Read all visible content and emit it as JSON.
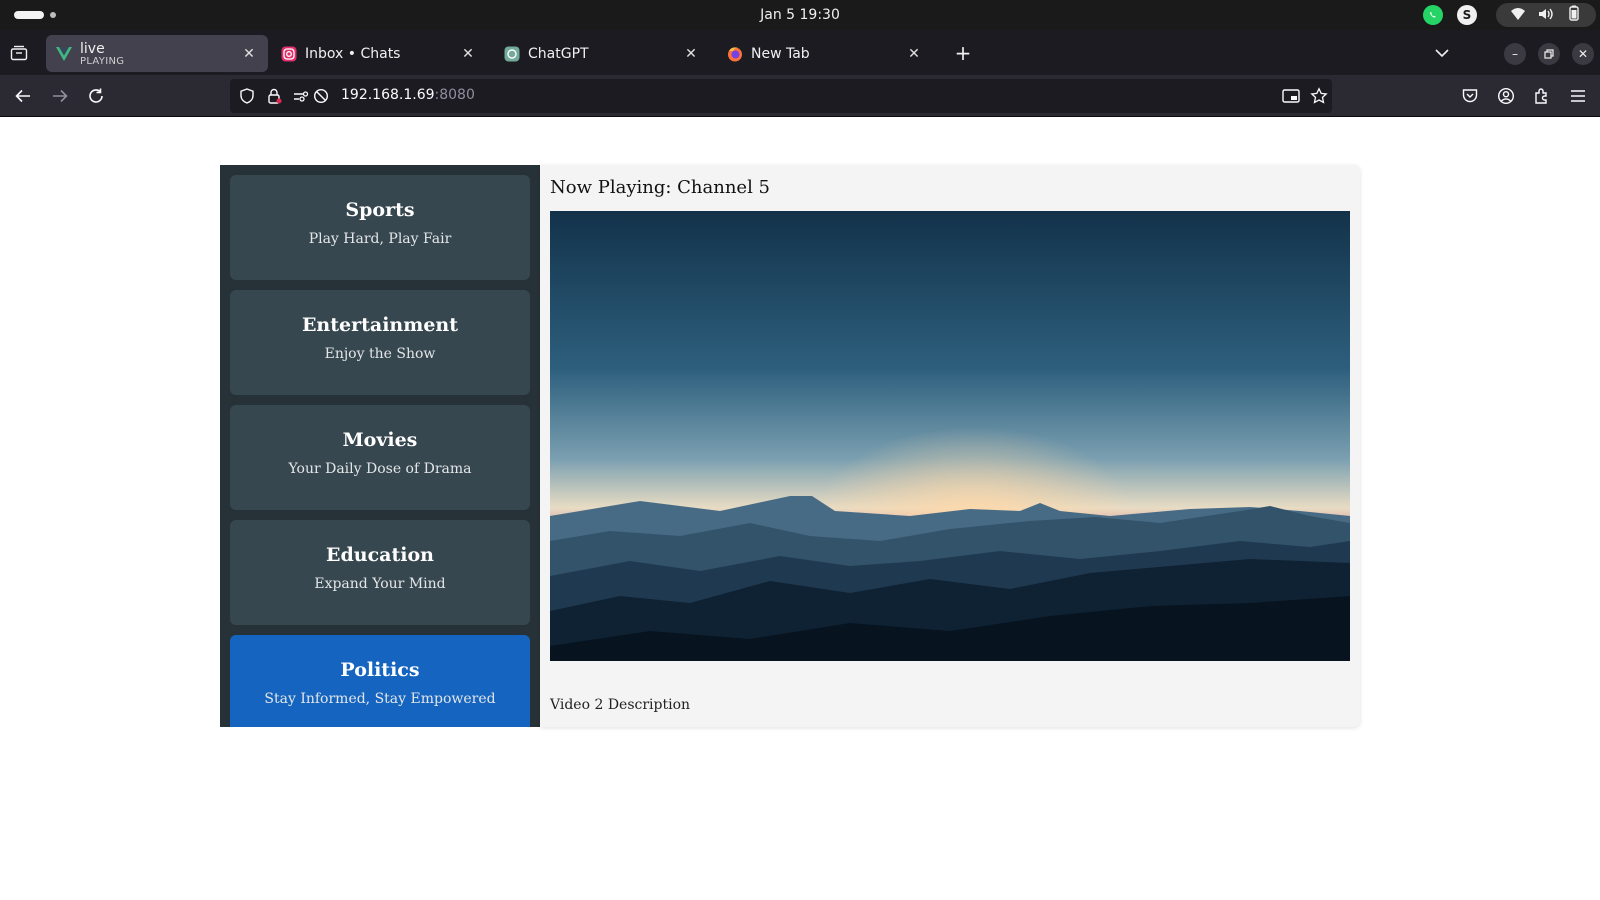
{
  "system": {
    "clock": "Jan 5  19:30",
    "tray_apps": [
      "whatsapp-icon",
      "skype-icon"
    ],
    "tray_status": [
      "wifi-icon",
      "volume-icon",
      "battery-icon"
    ]
  },
  "browser": {
    "tabs": [
      {
        "label": "live",
        "sublabel": "PLAYING",
        "favicon": "vue-icon",
        "active": true
      },
      {
        "label": "Inbox • Chats",
        "favicon": "instagram-icon",
        "active": false
      },
      {
        "label": "ChatGPT",
        "favicon": "chatgpt-icon",
        "active": false
      },
      {
        "label": "New Tab",
        "favicon": "firefox-icon",
        "active": false
      }
    ],
    "url": {
      "host": "192.168.1.69",
      "port": ":8080"
    },
    "colors": {
      "tabbar": "#1c1b22",
      "toolbar": "#2b2a33",
      "active_tab": "#42414d"
    }
  },
  "page": {
    "channels": [
      {
        "title": "Sports",
        "tagline": "Play Hard, Play Fair",
        "active": false
      },
      {
        "title": "Entertainment",
        "tagline": "Enjoy the Show",
        "active": false
      },
      {
        "title": "Movies",
        "tagline": "Your Daily Dose of Drama",
        "active": false
      },
      {
        "title": "Education",
        "tagline": "Expand Your Mind",
        "active": false
      },
      {
        "title": "Politics",
        "tagline": "Stay Informed, Stay Empowered",
        "active": true
      }
    ],
    "now_playing": "Now Playing: Channel 5",
    "video_description": "Video 2 Description",
    "colors": {
      "sidebar": "#263238",
      "channel_card": "#37474f",
      "channel_active": "#1565c0",
      "main_bg": "#f4f4f4"
    }
  }
}
